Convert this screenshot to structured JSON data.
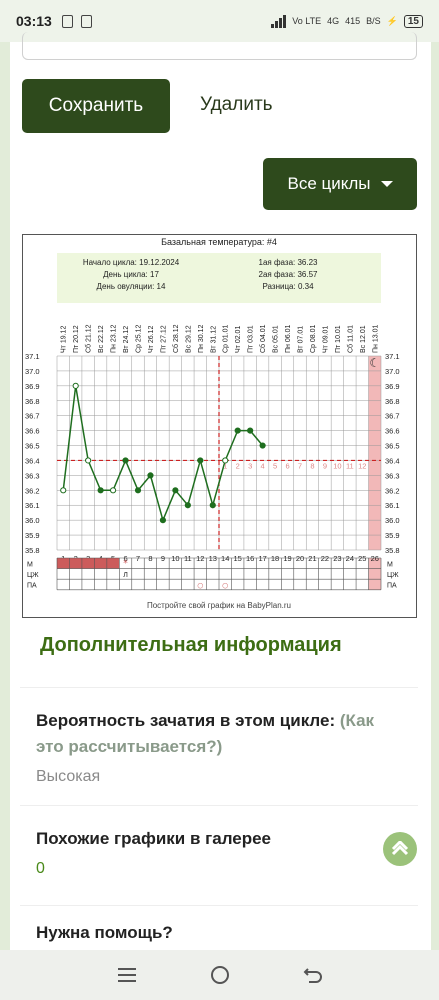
{
  "status_bar": {
    "time": "03:13",
    "network_label": "Vo LTE",
    "network_type": "4G",
    "speed": "415",
    "speed_unit": "B/S",
    "battery": "15"
  },
  "actions": {
    "save_label": "Сохранить",
    "delete_label": "Удалить",
    "cycles_label": "Все циклы"
  },
  "chart_data": {
    "type": "line",
    "title": "Базальная температура: #4",
    "summary": {
      "cycle_start": "Начало цикла: 19.12.2024",
      "cycle_day": "День цикла: 17",
      "ovulation_day": "День овуляции: 14",
      "phase1": "1ая фаза: 36.23",
      "phase2": "2ая фаза: 36.57",
      "difference": "Разница: 0.34"
    },
    "dates": [
      "Чт 19.12",
      "Пт 20.12",
      "Сб 21.12",
      "Вс 22.12",
      "Пн 23.12",
      "Вт 24.12",
      "Ср 25.12",
      "Чт 26.12",
      "Пт 27.12",
      "Сб 28.12",
      "Вс 29.12",
      "Пн 30.12",
      "Вт 31.12",
      "Ср 01.01",
      "Чт 02.01",
      "Пт 03.01",
      "Сб 04.01",
      "Вс 05.01",
      "Пн 06.01",
      "Вт 07.01",
      "Ср 08.01",
      "Чт 09.01",
      "Пт 10.01",
      "Сб 11.01",
      "Вс 12.01",
      "Пн 13.01"
    ],
    "days": [
      "1",
      "2",
      "3",
      "4",
      "5",
      "6",
      "7",
      "8",
      "9",
      "10",
      "11",
      "12",
      "13",
      "14",
      "15",
      "16",
      "17",
      "18",
      "19",
      "20",
      "21",
      "22",
      "23",
      "24",
      "25",
      "26"
    ],
    "post_ovulation_days": [
      "1",
      "2",
      "3",
      "4",
      "5",
      "6",
      "7",
      "8",
      "9",
      "10",
      "11",
      "12"
    ],
    "y_ticks": [
      "37.1",
      "37.0",
      "36.9",
      "36.8",
      "36.7",
      "36.6",
      "36.5",
      "36.4",
      "36.3",
      "36.2",
      "36.1",
      "36.0",
      "35.9",
      "35.8"
    ],
    "ylim": [
      35.8,
      37.1
    ],
    "temperatures": [
      36.2,
      36.9,
      36.4,
      36.2,
      36.2,
      36.4,
      36.2,
      36.3,
      36.0,
      36.2,
      36.1,
      36.4,
      36.1,
      36.4,
      36.6,
      36.6,
      36.5
    ],
    "open_markers": [
      1,
      2,
      3,
      5,
      14
    ],
    "coverline": 36.4,
    "ovulation_day": 14,
    "row_labels": [
      "М",
      "ЦЖ",
      "ПА"
    ],
    "menstruation_days": 5,
    "star_day": 6,
    "cm_day": 6,
    "cm_mark": "Л",
    "pa_days": [
      12,
      14
    ],
    "pa_mark": "○",
    "star_mark": "*",
    "moon_mark": "☾",
    "footer": "Постройте свой график на BabyPlan.ru"
  },
  "info": {
    "title": "Дополнительная информация",
    "conception_label": "Вероятность зачатия в этом цикле:",
    "conception_link": "(Как это рассчитывается?)",
    "conception_value": "Высокая",
    "similar_label": "Похожие графики в галерее",
    "similar_value": "0",
    "help_label": "Нужна помощь?"
  },
  "colors": {
    "primary": "#2e4a1c",
    "accent_green": "#3d6d14",
    "line": "#1f6e1f",
    "coverline": "#cc2222",
    "luteal_band": "#f2b8b8",
    "summary_bg": "#eef7dd"
  }
}
